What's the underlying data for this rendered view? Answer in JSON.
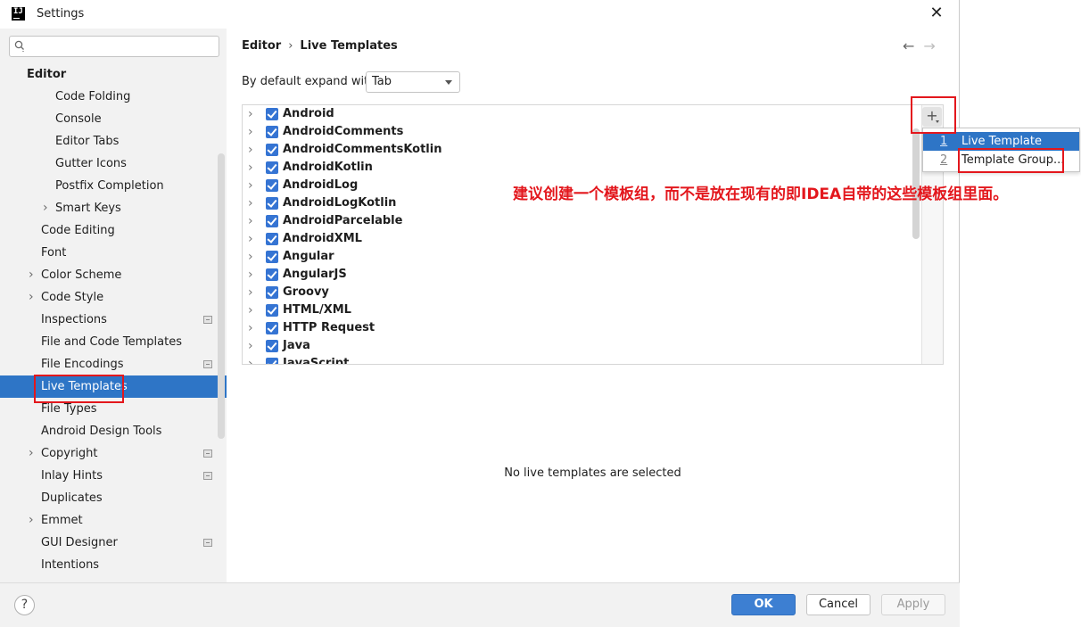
{
  "window": {
    "title": "Settings",
    "app_logo_text": "IJ"
  },
  "search": {
    "placeholder": ""
  },
  "sidebar": {
    "items": [
      {
        "label": "Editor",
        "header": true
      },
      {
        "label": "Code Folding"
      },
      {
        "label": "Console"
      },
      {
        "label": "Editor Tabs"
      },
      {
        "label": "Gutter Icons"
      },
      {
        "label": "Postfix Completion"
      },
      {
        "label": "Smart Keys",
        "expandable": true
      },
      {
        "label": "Code Editing"
      },
      {
        "label": "Font"
      },
      {
        "label": "Color Scheme",
        "expandable": true
      },
      {
        "label": "Code Style",
        "expandable": true
      },
      {
        "label": "Inspections",
        "badge": true
      },
      {
        "label": "File and Code Templates"
      },
      {
        "label": "File Encodings",
        "badge": true
      },
      {
        "label": "Live Templates",
        "selected": true
      },
      {
        "label": "File Types"
      },
      {
        "label": "Android Design Tools"
      },
      {
        "label": "Copyright",
        "expandable": true,
        "badge": true
      },
      {
        "label": "Inlay Hints",
        "badge": true
      },
      {
        "label": "Duplicates"
      },
      {
        "label": "Emmet",
        "expandable": true
      },
      {
        "label": "GUI Designer",
        "badge": true
      },
      {
        "label": "Intentions"
      }
    ]
  },
  "breadcrumb": {
    "parent": "Editor",
    "separator": "›",
    "current": "Live Templates"
  },
  "nav": {
    "back": "←",
    "forward": "→"
  },
  "expand": {
    "label": "By default expand with",
    "value": "Tab"
  },
  "templates": {
    "groups": [
      "Android",
      "AndroidComments",
      "AndroidCommentsKotlin",
      "AndroidKotlin",
      "AndroidLog",
      "AndroidLogKotlin",
      "AndroidParcelable",
      "AndroidXML",
      "Angular",
      "AngularJS",
      "Groovy",
      "HTML/XML",
      "HTTP Request",
      "Java",
      "JavaScript"
    ],
    "add_button": "+",
    "empty_message": "No live templates are selected"
  },
  "add_menu": {
    "items": [
      {
        "num": "1",
        "label": "Live Template",
        "selected": true
      },
      {
        "num": "2",
        "label": "Template Group..."
      }
    ]
  },
  "annotation": {
    "text": "建议创建一个模板组，而不是放在现有的即IDEA自带的这些模板组里面。",
    "color": "#e3171d"
  },
  "footer": {
    "help": "?",
    "ok": "OK",
    "cancel": "Cancel",
    "apply": "Apply"
  },
  "colors": {
    "accent": "#2e75c6",
    "checkbox": "#3574d3",
    "highlight_box": "#e3171d"
  }
}
